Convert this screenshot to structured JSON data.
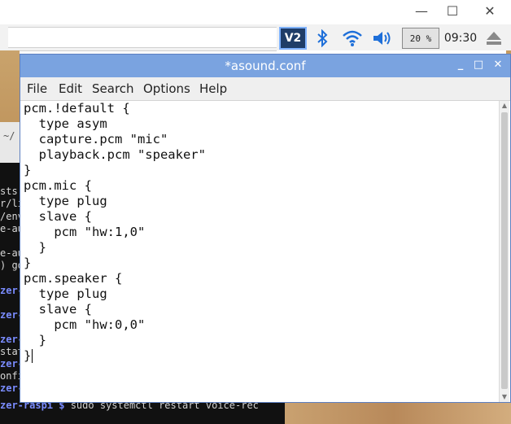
{
  "host": {
    "minimize_glyph": "—",
    "maximize_glyph": "☐",
    "close_glyph": "✕"
  },
  "tray": {
    "vnc_label": "V2",
    "bluetooth_glyph": "✱",
    "cpu_usage": "20 %",
    "clock": "09:30"
  },
  "terminal": {
    "peek_lines": [
      "sts",
      "r/li",
      "/env",
      "e-au",
      "",
      "e-au",
      ") go",
      "",
      "zer-",
      "",
      "zer-",
      "",
      "zer-",
      "stat",
      "zer-",
      "onfi",
      "zer-"
    ],
    "prompt": "zer-raspi $",
    "command": " sudo systemctl restart voice-rec",
    "top_text": "~/"
  },
  "window": {
    "title": "*asound.conf",
    "minimize_glyph": "_",
    "maximize_glyph": "□",
    "close_glyph": "✕"
  },
  "menu": {
    "file": "File",
    "edit": "Edit",
    "search": "Search",
    "options": "Options",
    "help": "Help"
  },
  "editor": {
    "content": "pcm.!default {\n  type asym\n  capture.pcm \"mic\"\n  playback.pcm \"speaker\"\n}\npcm.mic {\n  type plug\n  slave {\n    pcm \"hw:1,0\"\n  }\n}\npcm.speaker {\n  type plug\n  slave {\n    pcm \"hw:0,0\"\n  }\n}"
  },
  "colors": {
    "titlebar": "#7aa3e0",
    "menubar": "#efefef",
    "terminal_bg": "#111111",
    "prompt": "#7a8cff"
  }
}
